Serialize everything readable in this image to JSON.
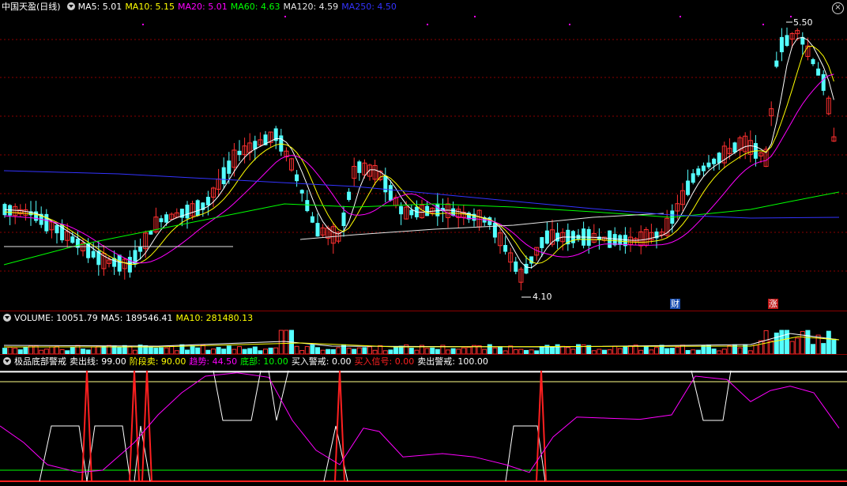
{
  "main": {
    "title": "中国天盈(日线)",
    "ma": [
      {
        "label": "MA5: 5.01",
        "color": "#ffffff"
      },
      {
        "label": "MA10: 5.15",
        "color": "#ffff00"
      },
      {
        "label": "MA20: 5.01",
        "color": "#ff00ff"
      },
      {
        "label": "MA60: 4.63",
        "color": "#00ff00"
      },
      {
        "label": "MA120: 4.59",
        "color": "#e6e6e6"
      },
      {
        "label": "MA250: 4.50",
        "color": "#3333ff"
      }
    ],
    "high_label": "5.50",
    "low_label": "4.10",
    "tag_cai": "财",
    "tag_zhang": "涨"
  },
  "volume": {
    "items": [
      {
        "label": "VOLUME: 10051.79",
        "color": "#ffffff"
      },
      {
        "label": "MA5: 189546.41",
        "color": "#ffffff"
      },
      {
        "label": "MA10: 281480.13",
        "color": "#ffff00"
      }
    ]
  },
  "indicator": {
    "name": "极品底部警戒",
    "items": [
      {
        "label": "卖出线: 99.00",
        "color": "#ffffff"
      },
      {
        "label": "阶段卖: 90.00",
        "color": "#ffff00"
      },
      {
        "label": "趋势: 44.50",
        "color": "#ff00ff"
      },
      {
        "label": "底部: 10.00",
        "color": "#00ff00"
      },
      {
        "label": "买入警戒: 0.00",
        "color": "#ffffff"
      },
      {
        "label": "买入信号: 0.00",
        "color": "#ff2020"
      },
      {
        "label": "卖出警戒: 100.00",
        "color": "#ffffff"
      }
    ]
  },
  "colors": {
    "up": "#ff3030",
    "down": "#54ffff",
    "grid": "#8b0000"
  }
}
